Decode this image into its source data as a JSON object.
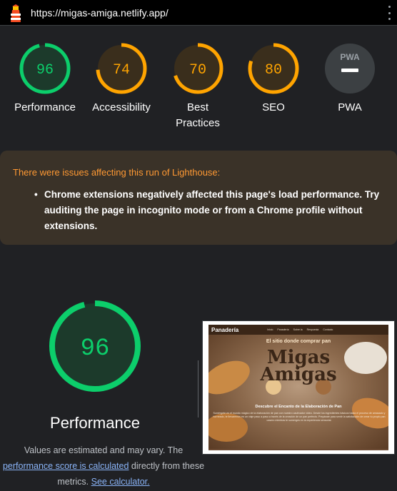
{
  "topbar": {
    "url": "https://migas-amiga.netlify.app/",
    "logo_icon": "lighthouse-icon",
    "menu_icon": "kebab-menu-icon"
  },
  "colors": {
    "pass": "#0cce6b",
    "average": "#ffa400",
    "pass_fill": "#1c3a2b",
    "average_fill": "#3a2e1c",
    "warning_text": "#ff9933",
    "link": "#8ab4f8"
  },
  "gauges": [
    {
      "label": "Performance",
      "score": "96",
      "fraction": 0.96,
      "status": "pass"
    },
    {
      "label": "Accessibility",
      "score": "74",
      "fraction": 0.74,
      "status": "average"
    },
    {
      "label": "Best Practices",
      "score": "70",
      "fraction": 0.7,
      "status": "average"
    },
    {
      "label": "SEO",
      "score": "80",
      "fraction": 0.8,
      "status": "average"
    },
    {
      "label": "PWA",
      "score": "PWA",
      "status": "na"
    }
  ],
  "warning": {
    "title": "There were issues affecting this run of Lighthouse:",
    "items": [
      "Chrome extensions negatively affected this page's load performance. Try auditing the page in incognito mode or from a Chrome profile without extensions."
    ]
  },
  "performance": {
    "score": "96",
    "fraction": 0.96,
    "title": "Performance",
    "note_1": "Values are estimated and may vary. The",
    "link_1": "performance score is calculated",
    "note_2": "directly from these metrics.",
    "link_2": "See calculator."
  },
  "screenshot": {
    "brand": "Panadería",
    "nav": [
      "Inicio",
      "Panadería",
      "Sobre la",
      "Respuesta",
      "Contacto"
    ],
    "subtitle": "El sitio donde comprar pan",
    "logo_line1": "Migas",
    "logo_line2": "Amigas",
    "heading": "Descubre el Encanto de la Elaboración de Pan",
    "paragraph": "Sumérgete en el mundo mágico de la elaboración de pan con nuestro cautivador video. Desde los ingredientes básicos hasta el proceso de amasado y horneado, te llevaremos en un viaje paso a paso a través de la creación de un pan perfecto. Prepárate para sentir la satisfacción de crear tu propio pan casero mientras te sumerges en la experiencia sensorial."
  }
}
